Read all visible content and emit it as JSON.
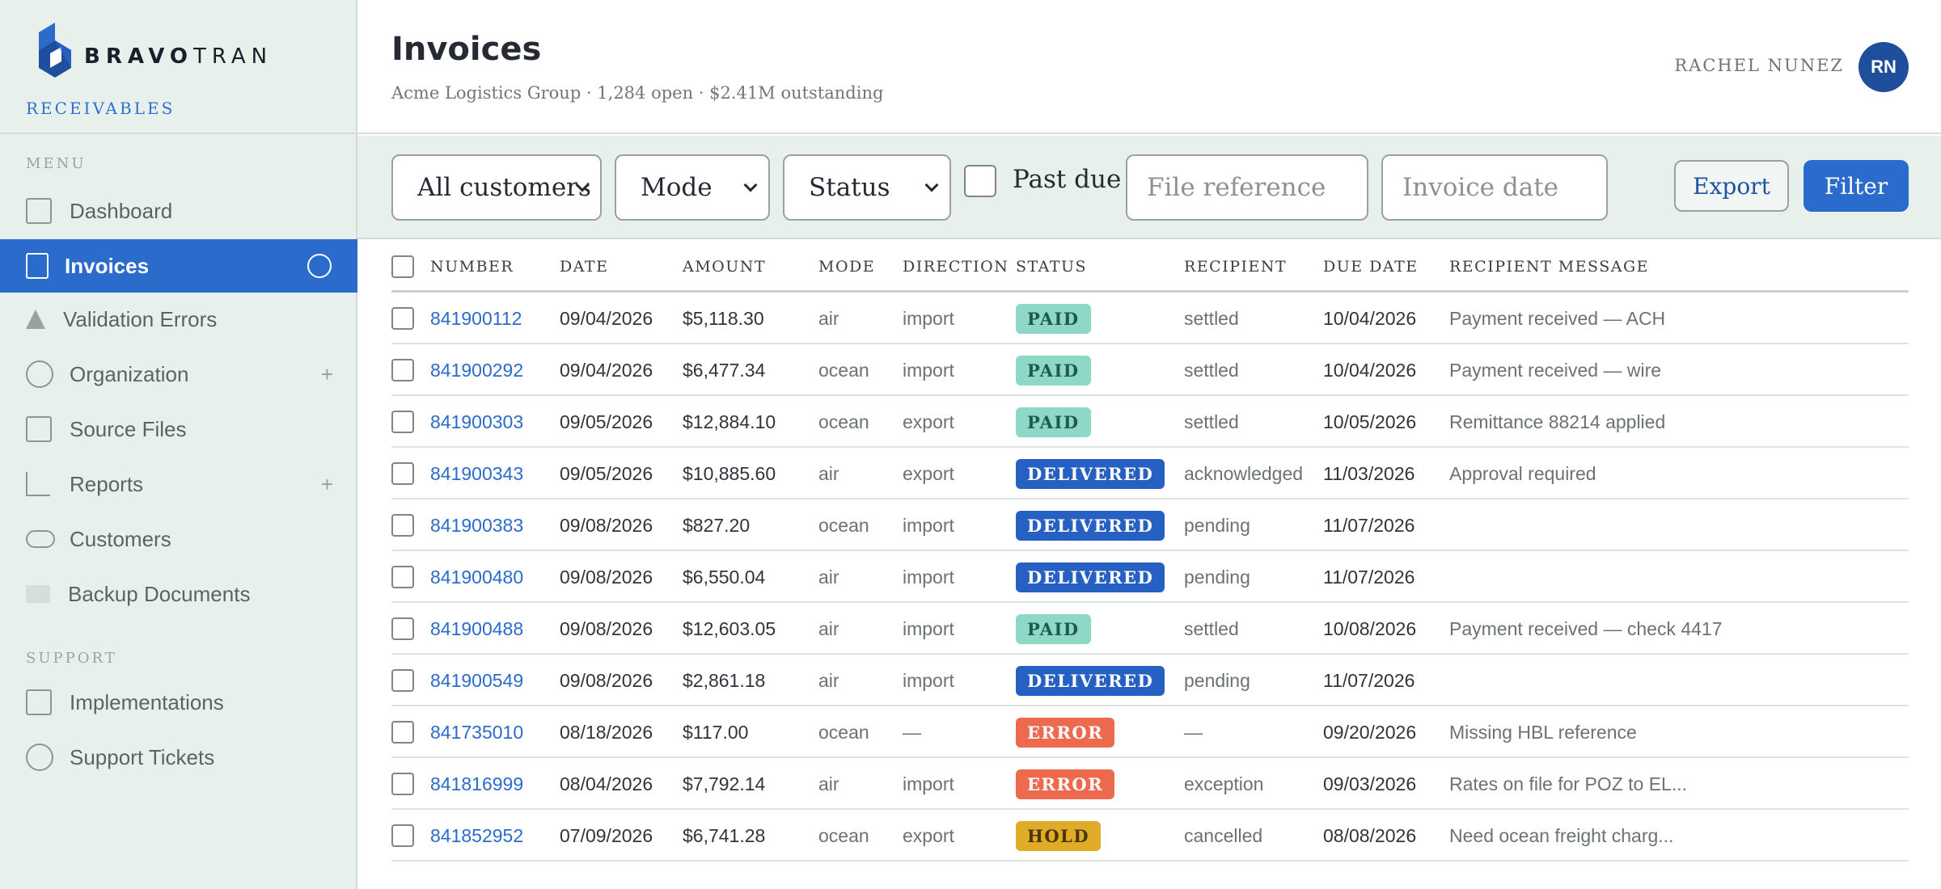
{
  "brand": {
    "name_bold": "BRAVO",
    "name_light": "TRAN",
    "section": "RECEIVABLES"
  },
  "nav": {
    "menu_heading": "MENU",
    "support_heading": "SUPPORT",
    "items": [
      {
        "label": "Dashboard",
        "icon": "square-icon"
      },
      {
        "label": "Invoices",
        "icon": "square-icon",
        "active": true
      },
      {
        "label": "Validation Errors",
        "icon": "triangle-icon"
      },
      {
        "label": "Organization",
        "icon": "circle-icon",
        "expand": "+"
      },
      {
        "label": "Source Files",
        "icon": "square-icon"
      },
      {
        "label": "Reports",
        "icon": "chart-icon",
        "expand": "+"
      },
      {
        "label": "Customers",
        "icon": "pill-icon"
      },
      {
        "label": "Backup Documents",
        "icon": "block-icon"
      }
    ],
    "support_items": [
      {
        "label": "Implementations",
        "icon": "square-icon"
      },
      {
        "label": "Support Tickets",
        "icon": "circle-icon"
      }
    ]
  },
  "header": {
    "title": "Invoices",
    "subtitle": "Acme Logistics Group · 1,284 open · $2.41M outstanding",
    "user_name": "RACHEL NUNEZ",
    "avatar_initials": "RN"
  },
  "filters": {
    "customer": "All customers",
    "mode": "Mode",
    "status": "Status",
    "past_due_label": "Past due",
    "file_reference_placeholder": "File reference",
    "invoice_date_placeholder": "Invoice date",
    "export_label": "Export",
    "filter_label": "Filter"
  },
  "table": {
    "columns": [
      "NUMBER",
      "DATE",
      "AMOUNT",
      "MODE",
      "DIRECTION",
      "STATUS",
      "RECIPIENT",
      "DUE DATE",
      "RECIPIENT MESSAGE"
    ],
    "rows": [
      {
        "number": "841900112",
        "date": "09/04/2026",
        "amount": "$5,118.30",
        "mode": "air",
        "direction": "import",
        "status": "PAID",
        "recipient": "settled",
        "due": "10/04/2026",
        "message": "Payment received — ACH"
      },
      {
        "number": "841900292",
        "date": "09/04/2026",
        "amount": "$6,477.34",
        "mode": "ocean",
        "direction": "import",
        "status": "PAID",
        "recipient": "settled",
        "due": "10/04/2026",
        "message": "Payment received — wire"
      },
      {
        "number": "841900303",
        "date": "09/05/2026",
        "amount": "$12,884.10",
        "mode": "ocean",
        "direction": "export",
        "status": "PAID",
        "recipient": "settled",
        "due": "10/05/2026",
        "message": "Remittance 88214 applied"
      },
      {
        "number": "841900343",
        "date": "09/05/2026",
        "amount": "$10,885.60",
        "mode": "air",
        "direction": "export",
        "status": "DELIVERED",
        "recipient": "acknowledged",
        "due": "11/03/2026",
        "message": "Approval required"
      },
      {
        "number": "841900383",
        "date": "09/08/2026",
        "amount": "$827.20",
        "mode": "ocean",
        "direction": "import",
        "status": "DELIVERED",
        "recipient": "pending",
        "due": "11/07/2026",
        "message": ""
      },
      {
        "number": "841900480",
        "date": "09/08/2026",
        "amount": "$6,550.04",
        "mode": "air",
        "direction": "import",
        "status": "DELIVERED",
        "recipient": "pending",
        "due": "11/07/2026",
        "message": ""
      },
      {
        "number": "841900488",
        "date": "09/08/2026",
        "amount": "$12,603.05",
        "mode": "air",
        "direction": "import",
        "status": "PAID",
        "recipient": "settled",
        "due": "10/08/2026",
        "message": "Payment received — check 4417"
      },
      {
        "number": "841900549",
        "date": "09/08/2026",
        "amount": "$2,861.18",
        "mode": "air",
        "direction": "import",
        "status": "DELIVERED",
        "recipient": "pending",
        "due": "11/07/2026",
        "message": ""
      },
      {
        "number": "841735010",
        "date": "08/18/2026",
        "amount": "$117.00",
        "mode": "ocean",
        "direction": "—",
        "status": "ERROR",
        "recipient": "—",
        "due": "09/20/2026",
        "message": "Missing HBL reference"
      },
      {
        "number": "841816999",
        "date": "08/04/2026",
        "amount": "$7,792.14",
        "mode": "air",
        "direction": "import",
        "status": "ERROR",
        "recipient": "exception",
        "due": "09/03/2026",
        "message": "Rates on file for POZ to EL..."
      },
      {
        "number": "841852952",
        "date": "07/09/2026",
        "amount": "$6,741.28",
        "mode": "ocean",
        "direction": "export",
        "status": "HOLD",
        "recipient": "cancelled",
        "due": "08/08/2026",
        "message": "Need ocean freight charg..."
      }
    ]
  },
  "colors": {
    "accent": "#2a6bcc",
    "sidebar_bg": "#e8f0ec",
    "paid": "#8ed8c7",
    "delivered": "#2560c2",
    "error": "#ee6a4f",
    "hold": "#e0ac27"
  }
}
